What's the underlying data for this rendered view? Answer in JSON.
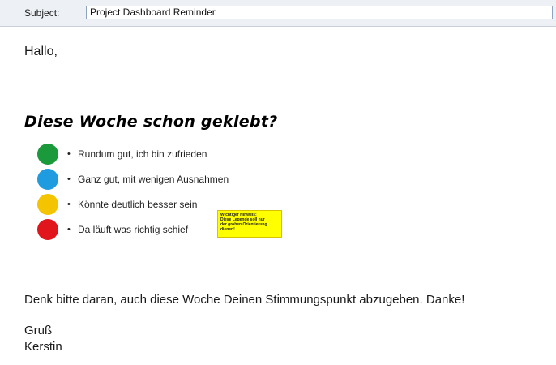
{
  "header": {
    "subject_label": "Subject:",
    "subject_value": "Project Dashboard Reminder"
  },
  "message": {
    "greeting": "Hallo,",
    "headline": "Diese Woche schon geklebt?",
    "legend": [
      {
        "color": "#1a9a3a",
        "bullet": "•",
        "label": "Rundum gut, ich bin zufrieden"
      },
      {
        "color": "#1f9be0",
        "bullet": "•",
        "label": "Ganz gut, mit wenigen Ausnahmen"
      },
      {
        "color": "#f5c400",
        "bullet": "•",
        "label": "Könnte deutlich besser sein"
      },
      {
        "color": "#e0161c",
        "bullet": "•",
        "label": "Da läuft was richtig schief"
      }
    ],
    "note": {
      "title": "Wichtiger Hinweis:",
      "lines": [
        "Diese Legende soll nur",
        "der groben Orientierung",
        "dienen!"
      ]
    },
    "reminder": "Denk bitte daran, auch diese Woche Deinen Stimmungspunkt abzugeben. Danke!",
    "closing": "Gruß",
    "signature": "Kerstin"
  }
}
